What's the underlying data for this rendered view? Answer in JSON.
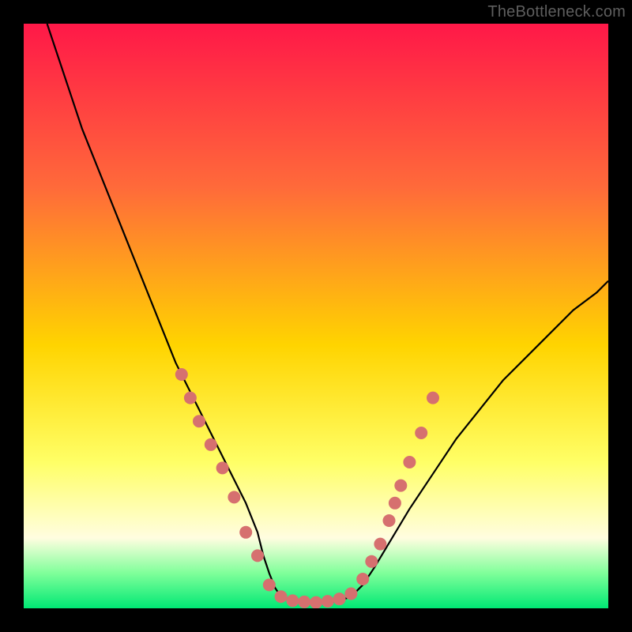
{
  "watermark": "TheBottleneck.com",
  "colors": {
    "bg_black": "#000000",
    "curve": "#000000",
    "marker_fill": "#d6706f",
    "marker_stroke": "#b85a59",
    "grad_top": "#ff1848",
    "grad_mid_upper": "#ff6a3a",
    "grad_mid": "#ffd400",
    "grad_mid_lower": "#ffff66",
    "grad_cream": "#fffde0",
    "grad_green_light": "#7fff9a",
    "grad_green": "#00e874"
  },
  "chart_data": {
    "type": "line",
    "title": "",
    "xlabel": "",
    "ylabel": "",
    "xlim": [
      0,
      100
    ],
    "ylim": [
      0,
      100
    ],
    "grid": false,
    "legend": false,
    "series": [
      {
        "name": "bottleneck-curve",
        "x": [
          4,
          6,
          8,
          10,
          12,
          14,
          16,
          18,
          20,
          22,
          24,
          26,
          28,
          30,
          32,
          34,
          36,
          38,
          40,
          41,
          42,
          43,
          44,
          46,
          48,
          50,
          52,
          54,
          56,
          58,
          60,
          63,
          66,
          70,
          74,
          78,
          82,
          86,
          90,
          94,
          98,
          100
        ],
        "y": [
          100,
          94,
          88,
          82,
          77,
          72,
          67,
          62,
          57,
          52,
          47,
          42,
          38,
          34,
          30,
          26,
          22,
          18,
          13,
          9,
          6,
          3.5,
          2,
          1.4,
          1.1,
          1.0,
          1.0,
          1.3,
          2.0,
          4.0,
          7.0,
          12,
          17,
          23,
          29,
          34,
          39,
          43,
          47,
          51,
          54,
          56
        ]
      }
    ],
    "markers": [
      {
        "x": 27,
        "y": 40
      },
      {
        "x": 28.5,
        "y": 36
      },
      {
        "x": 30,
        "y": 32
      },
      {
        "x": 32,
        "y": 28
      },
      {
        "x": 34,
        "y": 24
      },
      {
        "x": 36,
        "y": 19
      },
      {
        "x": 38,
        "y": 13
      },
      {
        "x": 40,
        "y": 9
      },
      {
        "x": 42,
        "y": 4
      },
      {
        "x": 44,
        "y": 2
      },
      {
        "x": 46,
        "y": 1.3
      },
      {
        "x": 48,
        "y": 1.1
      },
      {
        "x": 50,
        "y": 1.0
      },
      {
        "x": 52,
        "y": 1.2
      },
      {
        "x": 54,
        "y": 1.6
      },
      {
        "x": 56,
        "y": 2.5
      },
      {
        "x": 58,
        "y": 5
      },
      {
        "x": 59.5,
        "y": 8
      },
      {
        "x": 61,
        "y": 11
      },
      {
        "x": 62.5,
        "y": 15
      },
      {
        "x": 63.5,
        "y": 18
      },
      {
        "x": 64.5,
        "y": 21
      },
      {
        "x": 66,
        "y": 25
      },
      {
        "x": 68,
        "y": 30
      },
      {
        "x": 70,
        "y": 36
      }
    ]
  }
}
